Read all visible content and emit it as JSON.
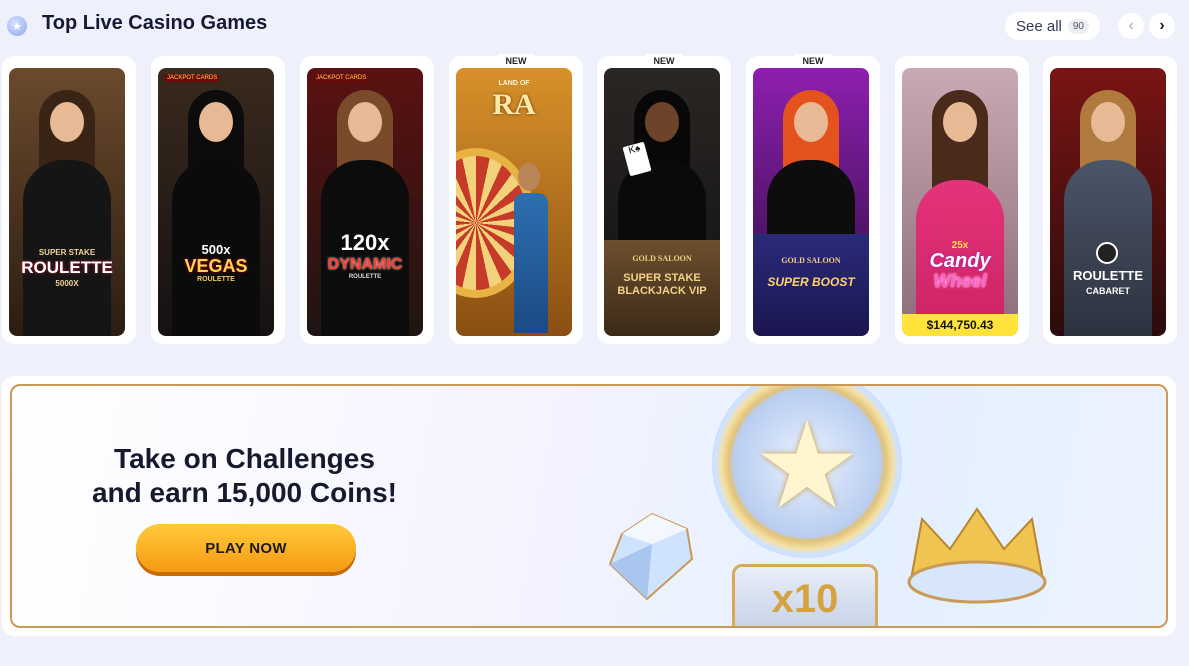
{
  "section": {
    "title": "Top Live Casino Games",
    "see_all_label": "See all",
    "see_all_count": "90"
  },
  "cards": [
    {
      "name": "Super Stake Roulette",
      "logo_top": "SUPER STAKE",
      "logo_main": "ROULETTE",
      "logo_sub": "5000X",
      "new": false
    },
    {
      "name": "500x Vegas Roulette",
      "logo_top": "500x",
      "logo_main": "VEGAS",
      "logo_sub": "ROULETTE",
      "jackpot_tag": "JACKPOT CARDS",
      "new": false
    },
    {
      "name": "120x Dynamic Roulette",
      "logo_top": "120x",
      "logo_main": "DYNAMIC",
      "logo_sub": "ROULETTE",
      "jackpot_tag": "JACKPOT CARDS",
      "new": false
    },
    {
      "name": "Land of Ra",
      "logo_top": "LAND OF",
      "logo_main": "RA",
      "new": true
    },
    {
      "name": "Gold Saloon Super Stake Blackjack VIP",
      "logo_top": "GOLD SALOON",
      "logo_main": "SUPER STAKE",
      "logo_sub": "BLACKJACK VIP",
      "new": true
    },
    {
      "name": "Gold Saloon Super Boost",
      "logo_top": "GOLD SALOON",
      "logo_main": "SUPER BOOST",
      "new": true
    },
    {
      "name": "Candy Wheel",
      "logo_top": "25x",
      "logo_main": "Candy",
      "logo_sub": "Wheel",
      "jackpot": "$144,750.43",
      "new": false
    },
    {
      "name": "Roulette Cabaret",
      "logo_main": "ROULETTE",
      "logo_sub": "CABARET",
      "new": false
    }
  ],
  "badge_new": "NEW",
  "banner": {
    "title_line1": "Take on Challenges",
    "title_line2": "and earn 15,000 Coins!",
    "button_label": "PLAY NOW",
    "multiplier": "x10"
  },
  "colors": {
    "accent": "#f6a21a",
    "banner_border": "#c99a57",
    "jackpot_bg": "#ffe33a"
  }
}
